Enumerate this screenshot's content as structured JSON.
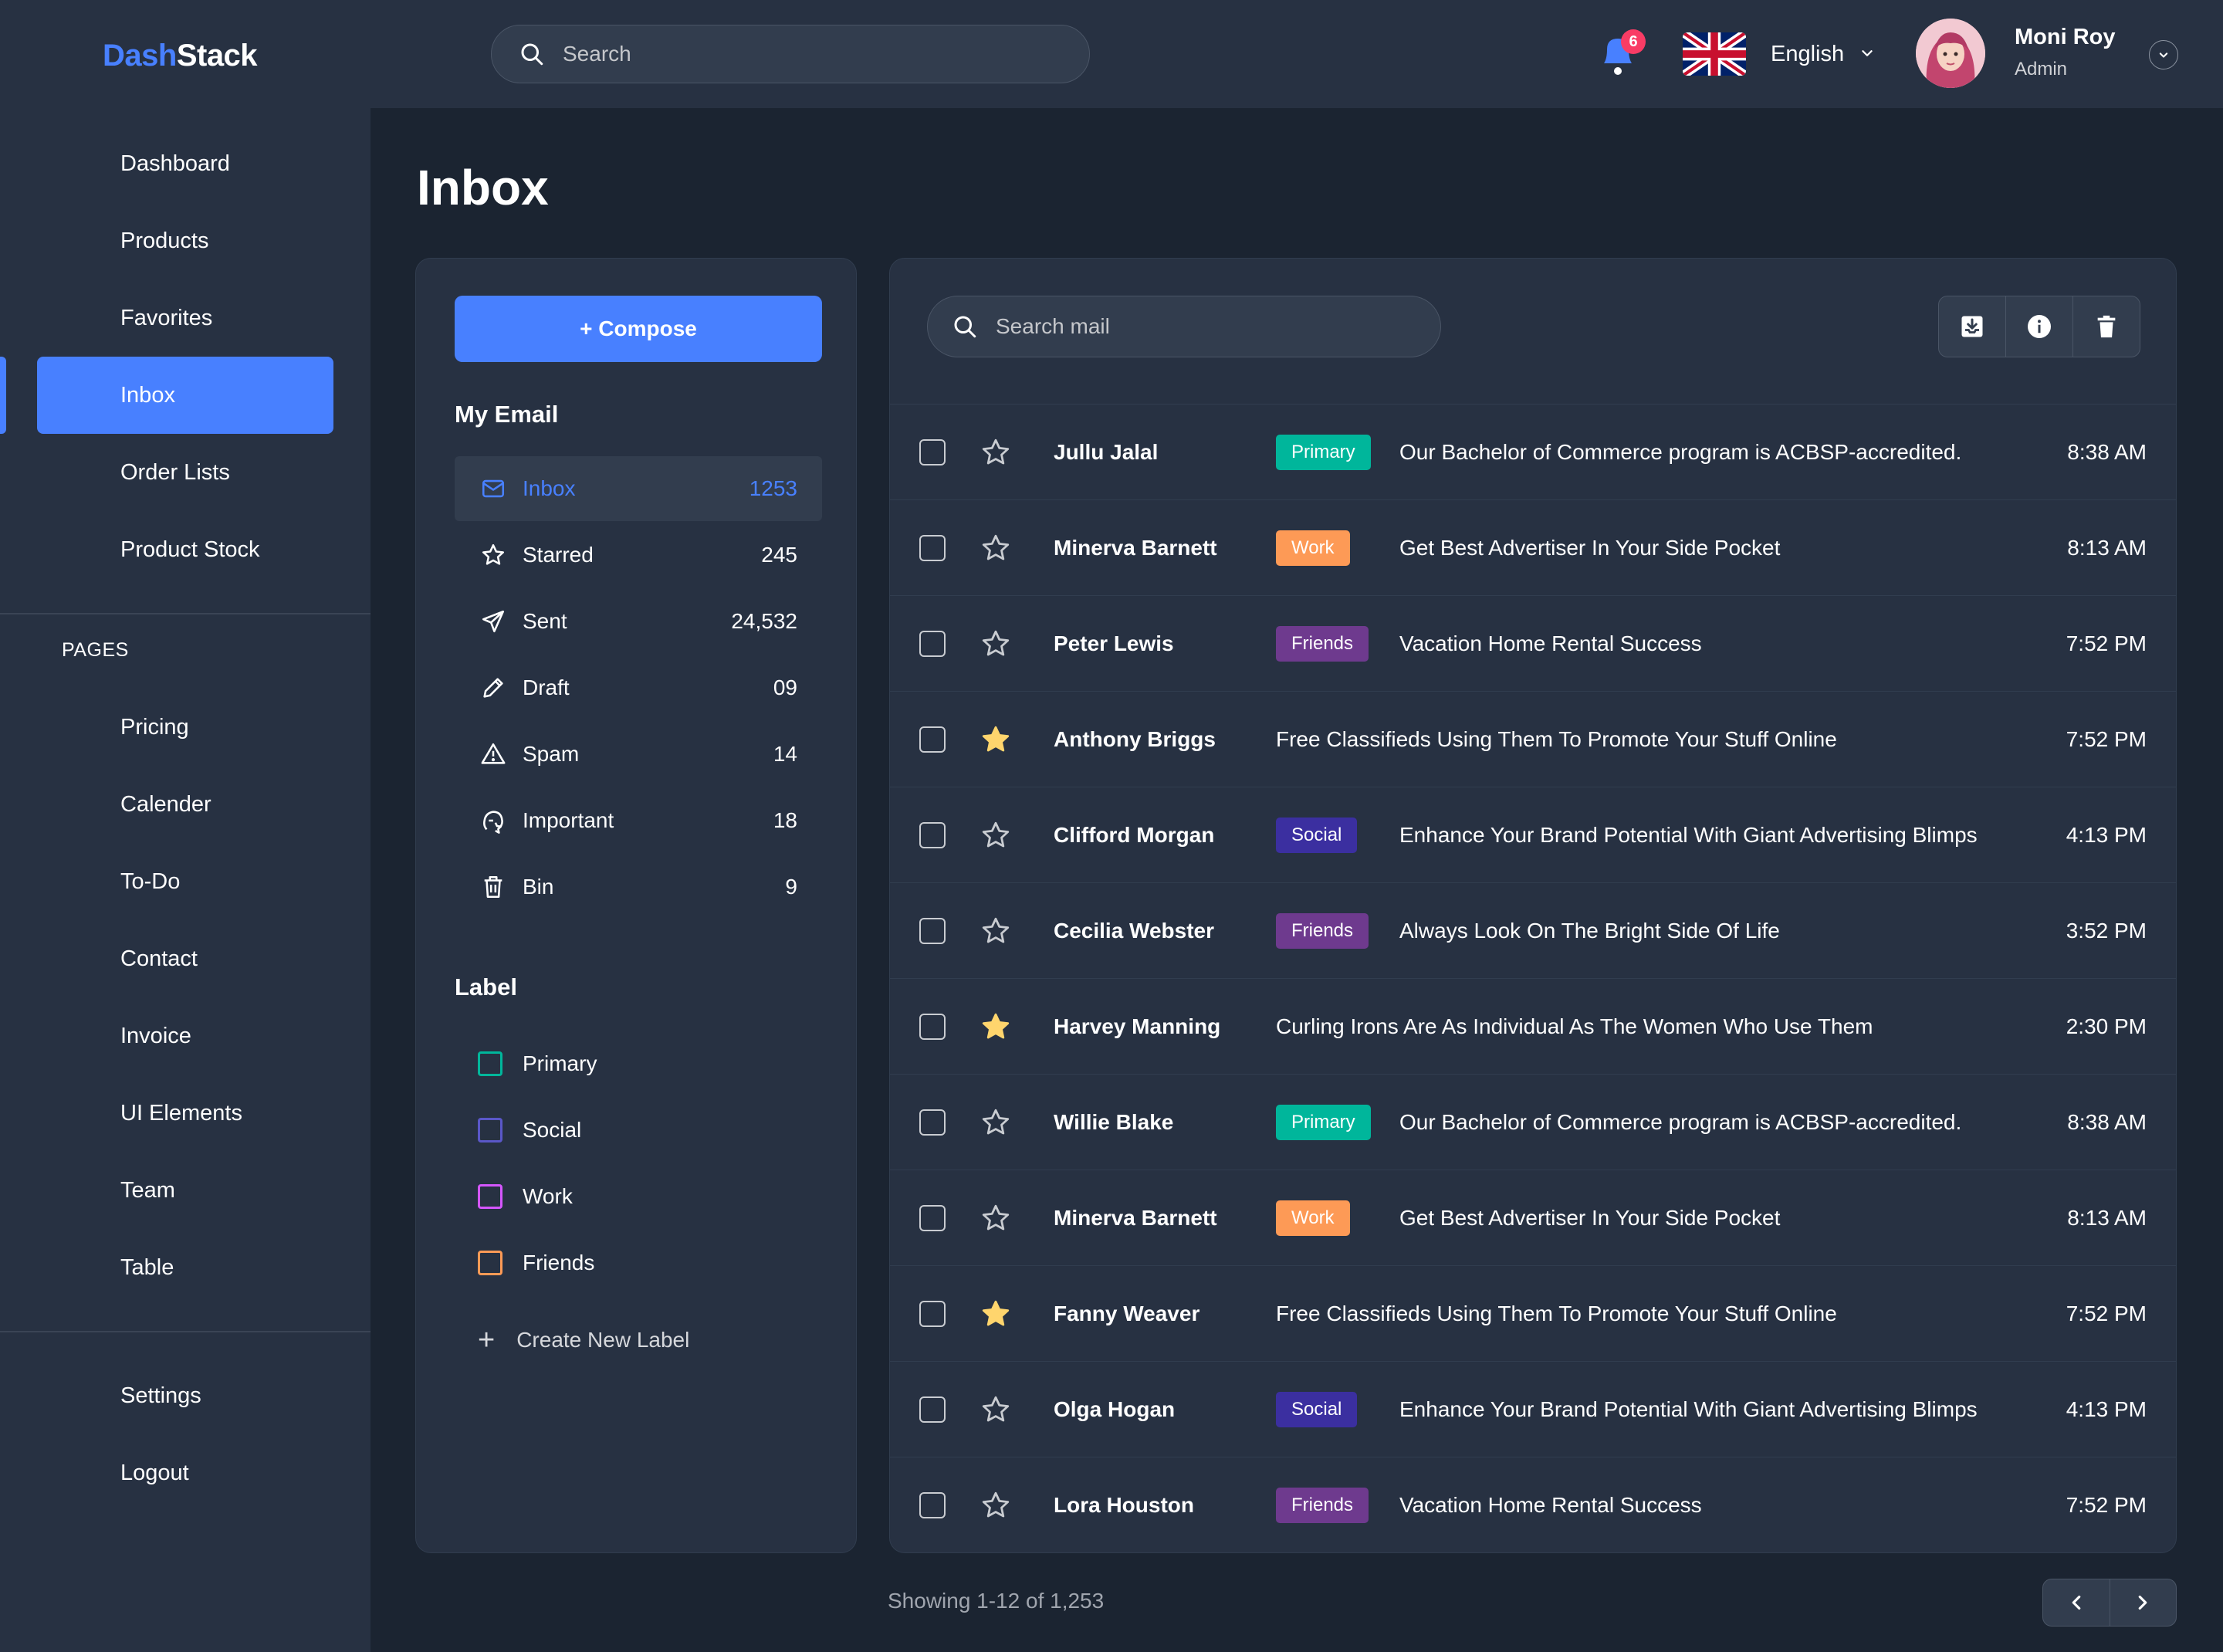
{
  "brand": {
    "part1": "Dash",
    "part2": "Stack"
  },
  "top_search": {
    "placeholder": "Search"
  },
  "notifications": {
    "count": "6"
  },
  "language": {
    "label": "English"
  },
  "user": {
    "name": "Moni Roy",
    "role": "Admin"
  },
  "sidebar": {
    "main_items": [
      {
        "label": "Dashboard"
      },
      {
        "label": "Products"
      },
      {
        "label": "Favorites"
      },
      {
        "label": "Inbox",
        "active": true
      },
      {
        "label": "Order Lists"
      },
      {
        "label": "Product Stock"
      }
    ],
    "pages_heading": "PAGES",
    "page_items": [
      {
        "label": "Pricing"
      },
      {
        "label": "Calender"
      },
      {
        "label": "To-Do"
      },
      {
        "label": "Contact"
      },
      {
        "label": "Invoice"
      },
      {
        "label": "UI Elements"
      },
      {
        "label": "Team"
      },
      {
        "label": "Table"
      }
    ],
    "bottom_items": [
      {
        "label": "Settings"
      },
      {
        "label": "Logout"
      }
    ]
  },
  "page_title": "Inbox",
  "compose_label": "+ Compose",
  "my_email": {
    "heading": "My Email",
    "folders": [
      {
        "label": "Inbox",
        "count": "1253",
        "icon": "mail-icon",
        "active": true
      },
      {
        "label": "Starred",
        "count": "245",
        "icon": "star-icon"
      },
      {
        "label": "Sent",
        "count": "24,532",
        "icon": "send-icon"
      },
      {
        "label": "Draft",
        "count": "09",
        "icon": "pencil-icon"
      },
      {
        "label": "Spam",
        "count": "14",
        "icon": "warning-icon"
      },
      {
        "label": "Important",
        "count": "18",
        "icon": "important-icon"
      },
      {
        "label": "Bin",
        "count": "9",
        "icon": "trash-icon"
      }
    ]
  },
  "labels": {
    "heading": "Label",
    "items": [
      {
        "label": "Primary",
        "color": "#00B69B"
      },
      {
        "label": "Social",
        "color": "#5A57C8"
      },
      {
        "label": "Work",
        "color": "#D456FD"
      },
      {
        "label": "Friends",
        "color": "#FD9A56"
      }
    ],
    "create_label": "Create New Label"
  },
  "mail_search": {
    "placeholder": "Search mail"
  },
  "tag_colors": {
    "Primary": "#00B69B",
    "Work": "#FD9A56",
    "Friends": "#6E3A8E",
    "Social": "#3B2FA0"
  },
  "mails": [
    {
      "sender": "Jullu Jalal",
      "tag": "Primary",
      "subject": "Our Bachelor of Commerce program is ACBSP-accredited.",
      "time": "8:38 AM",
      "starred": false
    },
    {
      "sender": "Minerva Barnett",
      "tag": "Work",
      "subject": "Get Best Advertiser In Your Side Pocket",
      "time": "8:13 AM",
      "starred": false
    },
    {
      "sender": "Peter Lewis",
      "tag": "Friends",
      "subject": "Vacation Home Rental Success",
      "time": "7:52 PM",
      "starred": false
    },
    {
      "sender": "Anthony Briggs",
      "tag": "",
      "subject": "Free Classifieds Using Them To Promote Your Stuff Online",
      "time": "7:52 PM",
      "starred": true
    },
    {
      "sender": "Clifford Morgan",
      "tag": "Social",
      "subject": "Enhance Your Brand Potential With Giant Advertising Blimps",
      "time": "4:13 PM",
      "starred": false
    },
    {
      "sender": "Cecilia Webster",
      "tag": "Friends",
      "subject": "Always Look On The Bright Side Of Life",
      "time": "3:52 PM",
      "starred": false
    },
    {
      "sender": "Harvey Manning",
      "tag": "",
      "subject": "Curling Irons Are As Individual As The Women Who Use Them",
      "time": "2:30 PM",
      "starred": true
    },
    {
      "sender": "Willie Blake",
      "tag": "Primary",
      "subject": "Our Bachelor of Commerce program is ACBSP-accredited.",
      "time": "8:38 AM",
      "starred": false
    },
    {
      "sender": "Minerva Barnett",
      "tag": "Work",
      "subject": "Get Best Advertiser In Your Side Pocket",
      "time": "8:13 AM",
      "starred": false
    },
    {
      "sender": "Fanny Weaver",
      "tag": "",
      "subject": "Free Classifieds Using Them To Promote Your Stuff Online",
      "time": "7:52 PM",
      "starred": true
    },
    {
      "sender": "Olga Hogan",
      "tag": "Social",
      "subject": "Enhance Your Brand Potential With Giant Advertising Blimps",
      "time": "4:13 PM",
      "starred": false
    },
    {
      "sender": "Lora Houston",
      "tag": "Friends",
      "subject": "Vacation Home Rental Success",
      "time": "7:52 PM",
      "starred": false
    }
  ],
  "pagination": {
    "summary": "Showing 1-12 of 1,253"
  },
  "colors": {
    "accent": "#4880FF",
    "bg": "#1B2431",
    "panel": "#273142",
    "star": "#FFD56D",
    "badge": "#F93C65"
  }
}
